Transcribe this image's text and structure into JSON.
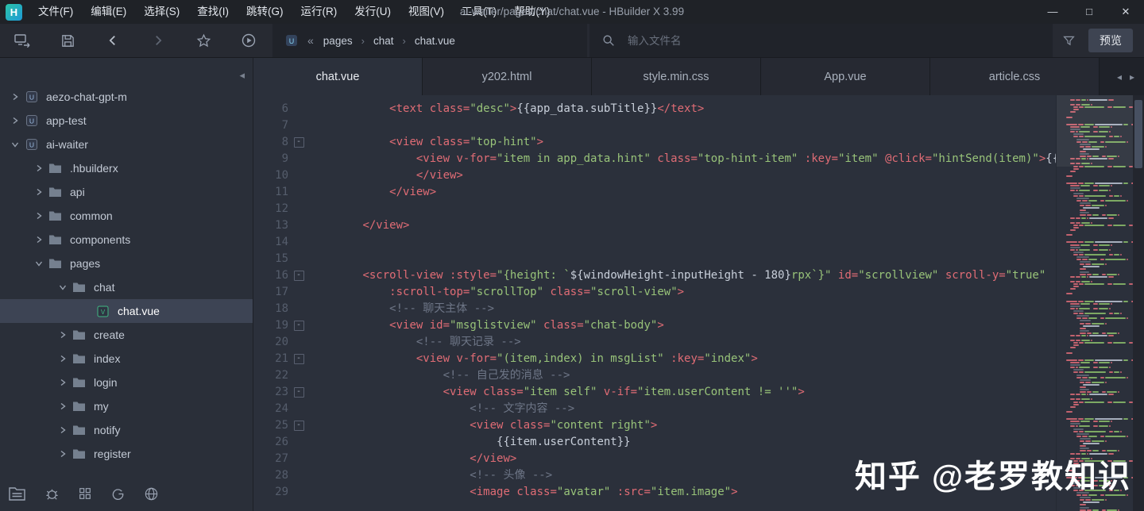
{
  "window": {
    "logo_letter": "H",
    "menu": [
      "文件(F)",
      "编辑(E)",
      "选择(S)",
      "查找(I)",
      "跳转(G)",
      "运行(R)",
      "发行(U)",
      "视图(V)",
      "工具(T)",
      "帮助(Y)"
    ],
    "title": "ai-waiter/pages/chat/chat.vue - HBuilder X 3.99",
    "controls": [
      {
        "name": "minimize-button",
        "glyph": "—"
      },
      {
        "name": "maximize-button",
        "glyph": "□"
      },
      {
        "name": "close-button",
        "glyph": "✕"
      }
    ]
  },
  "toolbar": {
    "icons": [
      "device-sync-icon",
      "save-icon",
      "back-icon",
      "forward-icon",
      "star-icon",
      "run-icon"
    ],
    "breadcrumb": {
      "collapse": "«",
      "separator": "›",
      "file_icon": "uniapp-file-icon",
      "items": [
        "pages",
        "chat",
        "chat.vue"
      ]
    },
    "search_placeholder": "输入文件名",
    "filter_icon": "filter-icon",
    "preview_label": "预览"
  },
  "sidebar": {
    "collapse_arrow": "◂",
    "tree": [
      {
        "label": "aezo-chat-gpt-m",
        "level": 0,
        "icon": "project",
        "arrow": "collapsed",
        "selected": false
      },
      {
        "label": "app-test",
        "level": 0,
        "icon": "project",
        "arrow": "collapsed",
        "selected": false
      },
      {
        "label": "ai-waiter",
        "level": 0,
        "icon": "project",
        "arrow": "expanded",
        "selected": false
      },
      {
        "label": ".hbuilderx",
        "level": 1,
        "icon": "folder",
        "arrow": "collapsed",
        "selected": false
      },
      {
        "label": "api",
        "level": 1,
        "icon": "folder",
        "arrow": "collapsed",
        "selected": false
      },
      {
        "label": "common",
        "level": 1,
        "icon": "folder",
        "arrow": "collapsed",
        "selected": false
      },
      {
        "label": "components",
        "level": 1,
        "icon": "folder",
        "arrow": "collapsed",
        "selected": false
      },
      {
        "label": "pages",
        "level": 1,
        "icon": "folder",
        "arrow": "expanded",
        "selected": false
      },
      {
        "label": "chat",
        "level": 2,
        "icon": "folder",
        "arrow": "expanded",
        "selected": false
      },
      {
        "label": "chat.vue",
        "level": 3,
        "icon": "vue",
        "arrow": "none",
        "selected": true
      },
      {
        "label": "create",
        "level": 2,
        "icon": "folder",
        "arrow": "collapsed",
        "selected": false
      },
      {
        "label": "index",
        "level": 2,
        "icon": "folder",
        "arrow": "collapsed",
        "selected": false
      },
      {
        "label": "login",
        "level": 2,
        "icon": "folder",
        "arrow": "collapsed",
        "selected": false
      },
      {
        "label": "my",
        "level": 2,
        "icon": "folder",
        "arrow": "collapsed",
        "selected": false
      },
      {
        "label": "notify",
        "level": 2,
        "icon": "folder",
        "arrow": "collapsed",
        "selected": false
      },
      {
        "label": "register",
        "level": 2,
        "icon": "folder",
        "arrow": "collapsed",
        "selected": false
      }
    ],
    "footer_icons": [
      "files-panel-icon",
      "bug-icon",
      "grid-icon",
      "letter-g-icon",
      "globe-icon"
    ]
  },
  "tabs": {
    "items": [
      {
        "label": "chat.vue",
        "active": true
      },
      {
        "label": "y202.html",
        "active": false
      },
      {
        "label": "style.min.css",
        "active": false
      },
      {
        "label": "App.vue",
        "active": false
      },
      {
        "label": "article.css",
        "active": false
      }
    ],
    "nav_left": "◂",
    "nav_right": "▸"
  },
  "editor": {
    "lines": [
      {
        "n": 6,
        "f": 0,
        "s": [
          [
            "ws",
            "            "
          ],
          [
            "tg",
            "<text "
          ],
          [
            "at",
            "class="
          ],
          [
            "st",
            "\"desc\""
          ],
          [
            "tg",
            ">"
          ],
          [
            "tx",
            "{{app_data.subTitle}}"
          ],
          [
            "tg",
            "</text>"
          ]
        ]
      },
      {
        "n": 7,
        "f": 0,
        "s": []
      },
      {
        "n": 8,
        "f": 1,
        "s": [
          [
            "ws",
            "            "
          ],
          [
            "tg",
            "<view "
          ],
          [
            "at",
            "class="
          ],
          [
            "st",
            "\"top-hint\""
          ],
          [
            "tg",
            ">"
          ]
        ]
      },
      {
        "n": 9,
        "f": 0,
        "s": [
          [
            "ws",
            "                "
          ],
          [
            "tg",
            "<view "
          ],
          [
            "at",
            "v-for="
          ],
          [
            "st",
            "\"item in app_data.hint\""
          ],
          [
            "ws",
            " "
          ],
          [
            "at",
            "class="
          ],
          [
            "st",
            "\"top-hint-item\""
          ],
          [
            "ws",
            " "
          ],
          [
            "at",
            ":key="
          ],
          [
            "st",
            "\"item\""
          ],
          [
            "ws",
            " "
          ],
          [
            "at",
            "@click="
          ],
          [
            "st",
            "\"hintSend(item)\""
          ],
          [
            "tg",
            ">"
          ],
          [
            "tx",
            "{{i"
          ]
        ]
      },
      {
        "n": 10,
        "f": 0,
        "s": [
          [
            "ws",
            "                "
          ],
          [
            "tg",
            "</view>"
          ]
        ]
      },
      {
        "n": 11,
        "f": 0,
        "s": [
          [
            "ws",
            "            "
          ],
          [
            "tg",
            "</view>"
          ]
        ]
      },
      {
        "n": 12,
        "f": 0,
        "s": []
      },
      {
        "n": 13,
        "f": 0,
        "s": [
          [
            "ws",
            "        "
          ],
          [
            "tg",
            "</view>"
          ]
        ]
      },
      {
        "n": 14,
        "f": 0,
        "s": []
      },
      {
        "n": 15,
        "f": 0,
        "s": []
      },
      {
        "n": 16,
        "f": 1,
        "s": [
          [
            "ws",
            "        "
          ],
          [
            "tg",
            "<scroll-view "
          ],
          [
            "at",
            ":style="
          ],
          [
            "st",
            "\"{height: `"
          ],
          [
            "tx",
            "${windowHeight-inputHeight - 180}"
          ],
          [
            "st",
            "rpx`}\""
          ],
          [
            "ws",
            " "
          ],
          [
            "at",
            "id="
          ],
          [
            "st",
            "\"scrollview\""
          ],
          [
            "ws",
            " "
          ],
          [
            "at",
            "scroll-y="
          ],
          [
            "st",
            "\"true\""
          ]
        ]
      },
      {
        "n": 17,
        "f": 0,
        "s": [
          [
            "ws",
            "            "
          ],
          [
            "at",
            ":scroll-top="
          ],
          [
            "st",
            "\"scrollTop\""
          ],
          [
            "ws",
            " "
          ],
          [
            "at",
            "class="
          ],
          [
            "st",
            "\"scroll-view\""
          ],
          [
            "tg",
            ">"
          ]
        ]
      },
      {
        "n": 18,
        "f": 0,
        "s": [
          [
            "ws",
            "            "
          ],
          [
            "cm",
            "<!-- 聊天主体 -->"
          ]
        ]
      },
      {
        "n": 19,
        "f": 1,
        "s": [
          [
            "ws",
            "            "
          ],
          [
            "tg",
            "<view "
          ],
          [
            "at",
            "id="
          ],
          [
            "st",
            "\"msglistview\""
          ],
          [
            "ws",
            " "
          ],
          [
            "at",
            "class="
          ],
          [
            "st",
            "\"chat-body\""
          ],
          [
            "tg",
            ">"
          ]
        ]
      },
      {
        "n": 20,
        "f": 0,
        "s": [
          [
            "ws",
            "                "
          ],
          [
            "cm",
            "<!-- 聊天记录 -->"
          ]
        ]
      },
      {
        "n": 21,
        "f": 1,
        "s": [
          [
            "ws",
            "                "
          ],
          [
            "tg",
            "<view "
          ],
          [
            "at",
            "v-for="
          ],
          [
            "st",
            "\"(item,index) in msgList\""
          ],
          [
            "ws",
            " "
          ],
          [
            "at",
            ":key="
          ],
          [
            "st",
            "\"index\""
          ],
          [
            "tg",
            ">"
          ]
        ]
      },
      {
        "n": 22,
        "f": 0,
        "s": [
          [
            "ws",
            "                    "
          ],
          [
            "cm",
            "<!-- 自己发的消息 -->"
          ]
        ]
      },
      {
        "n": 23,
        "f": 1,
        "s": [
          [
            "ws",
            "                    "
          ],
          [
            "tg",
            "<view "
          ],
          [
            "at",
            "class="
          ],
          [
            "st",
            "\"item self\""
          ],
          [
            "ws",
            " "
          ],
          [
            "at",
            "v-if="
          ],
          [
            "st",
            "\"item.userContent != ''\""
          ],
          [
            "tg",
            ">"
          ]
        ]
      },
      {
        "n": 24,
        "f": 0,
        "s": [
          [
            "ws",
            "                        "
          ],
          [
            "cm",
            "<!-- 文字内容 -->"
          ]
        ]
      },
      {
        "n": 25,
        "f": 1,
        "s": [
          [
            "ws",
            "                        "
          ],
          [
            "tg",
            "<view "
          ],
          [
            "at",
            "class="
          ],
          [
            "st",
            "\"content right\""
          ],
          [
            "tg",
            ">"
          ]
        ]
      },
      {
        "n": 26,
        "f": 0,
        "s": [
          [
            "ws",
            "                            "
          ],
          [
            "tx",
            "{{item.userContent}}"
          ]
        ]
      },
      {
        "n": 27,
        "f": 0,
        "s": [
          [
            "ws",
            "                        "
          ],
          [
            "tg",
            "</view>"
          ]
        ]
      },
      {
        "n": 28,
        "f": 0,
        "s": [
          [
            "ws",
            "                        "
          ],
          [
            "cm",
            "<!-- 头像 -->"
          ]
        ]
      },
      {
        "n": 29,
        "f": 0,
        "s": [
          [
            "ws",
            "                        "
          ],
          [
            "tg",
            "<image "
          ],
          [
            "at",
            "class="
          ],
          [
            "st",
            "\"avatar\""
          ],
          [
            "ws",
            " "
          ],
          [
            "at",
            ":src="
          ],
          [
            "st",
            "\"item.image\""
          ],
          [
            "tg",
            ">"
          ]
        ]
      }
    ]
  },
  "watermark": "知乎 @老罗教知识",
  "colors": {
    "tag": "#e06c75",
    "string": "#98c379",
    "comment": "#6e7687",
    "text": "#c8cfda",
    "selection": "#3d4454",
    "vue_green": "#41b883"
  }
}
